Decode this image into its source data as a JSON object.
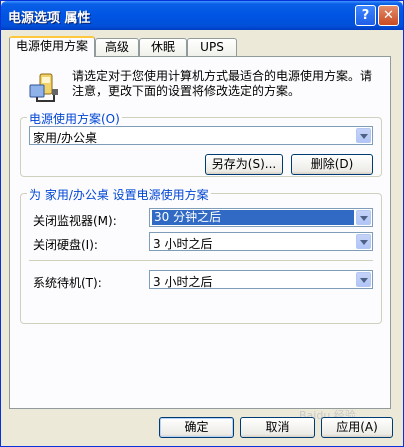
{
  "window": {
    "title": "电源选项 属性",
    "help_glyph": "?",
    "close_glyph": "✕"
  },
  "tabs": [
    {
      "label": "电源使用方案",
      "active": true
    },
    {
      "label": "高级"
    },
    {
      "label": "休眠"
    },
    {
      "label": "UPS"
    }
  ],
  "intro": {
    "icon": "power-options-icon",
    "text": "请选定对于您使用计算机方式最适合的电源使用方案。请注意，更改下面的设置将修改选定的方案。"
  },
  "schemes": {
    "group_label": "电源使用方案(O)",
    "selected": "家用/办公桌",
    "save_as_label": "另存为(S)...",
    "delete_label": "删除(D)"
  },
  "settings": {
    "group_label": "为 家用/办公桌 设置电源使用方案",
    "rows": [
      {
        "label": "关闭监视器(M):",
        "value": "30 分钟之后"
      },
      {
        "label": "关闭硬盘(I):",
        "value": "3 小时之后"
      },
      {
        "label": "系统待机(T):",
        "value": "3 小时之后"
      }
    ]
  },
  "footer": {
    "ok_label": "确定",
    "cancel_label": "取消",
    "apply_label": "应用(A)"
  },
  "watermark": "Baidu 经验",
  "colors": {
    "accent": "#0054e3",
    "selection": "#316ac5",
    "group_label": "#0046d5"
  }
}
